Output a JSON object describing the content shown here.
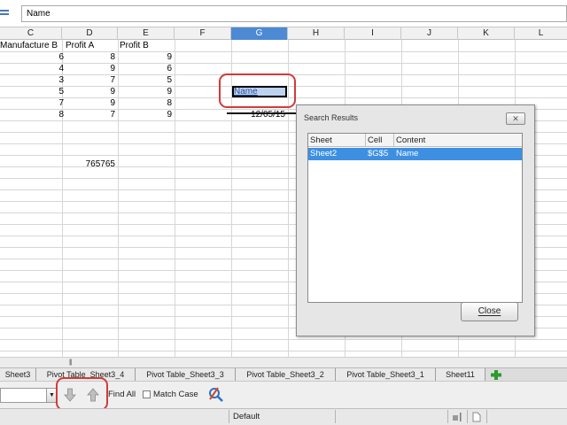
{
  "formula": {
    "value": "Name"
  },
  "columns": [
    {
      "label": "C",
      "selected": false
    },
    {
      "label": "D",
      "selected": false
    },
    {
      "label": "E",
      "selected": false
    },
    {
      "label": "F",
      "selected": false
    },
    {
      "label": "G",
      "selected": true
    },
    {
      "label": "H",
      "selected": false
    },
    {
      "label": "I",
      "selected": false
    },
    {
      "label": "J",
      "selected": false
    },
    {
      "label": "K",
      "selected": false
    },
    {
      "label": "L",
      "selected": false
    }
  ],
  "grid": {
    "headers": [
      "Manufacture B",
      "Profit A",
      "Profit B"
    ],
    "rows": [
      [
        "6",
        "8",
        "9"
      ],
      [
        "4",
        "9",
        "6"
      ],
      [
        "3",
        "7",
        "5"
      ],
      [
        "5",
        "9",
        "9"
      ],
      [
        "7",
        "9",
        "8"
      ],
      [
        "8",
        "7",
        "9"
      ]
    ],
    "selected_cell_value": "Name",
    "date_value": "12/05/15",
    "extra_value": "765765"
  },
  "dialog": {
    "title": "Search Results",
    "columns": [
      "Sheet",
      "Cell",
      "Content"
    ],
    "results": [
      {
        "sheet": "Sheet2",
        "cell": "$G$5",
        "content": "Name"
      }
    ],
    "close_label": "Close",
    "close_icon": "close-x-icon"
  },
  "sheet_tabs": [
    "Sheet3",
    "Pivot Table_Sheet3_4",
    "Pivot Table_Sheet3_3",
    "Pivot Table_Sheet3_2",
    "Pivot Table_Sheet3_1",
    "Sheet11"
  ],
  "findbar": {
    "find_all_label": "Find All",
    "match_case_label": "Match Case",
    "match_case_checked": false
  },
  "status": {
    "page_style": "Default"
  },
  "colors": {
    "selection_blue": "#3d8fe2",
    "column_selected": "#4c8ad4",
    "annotation_red": "#d23a3a"
  }
}
